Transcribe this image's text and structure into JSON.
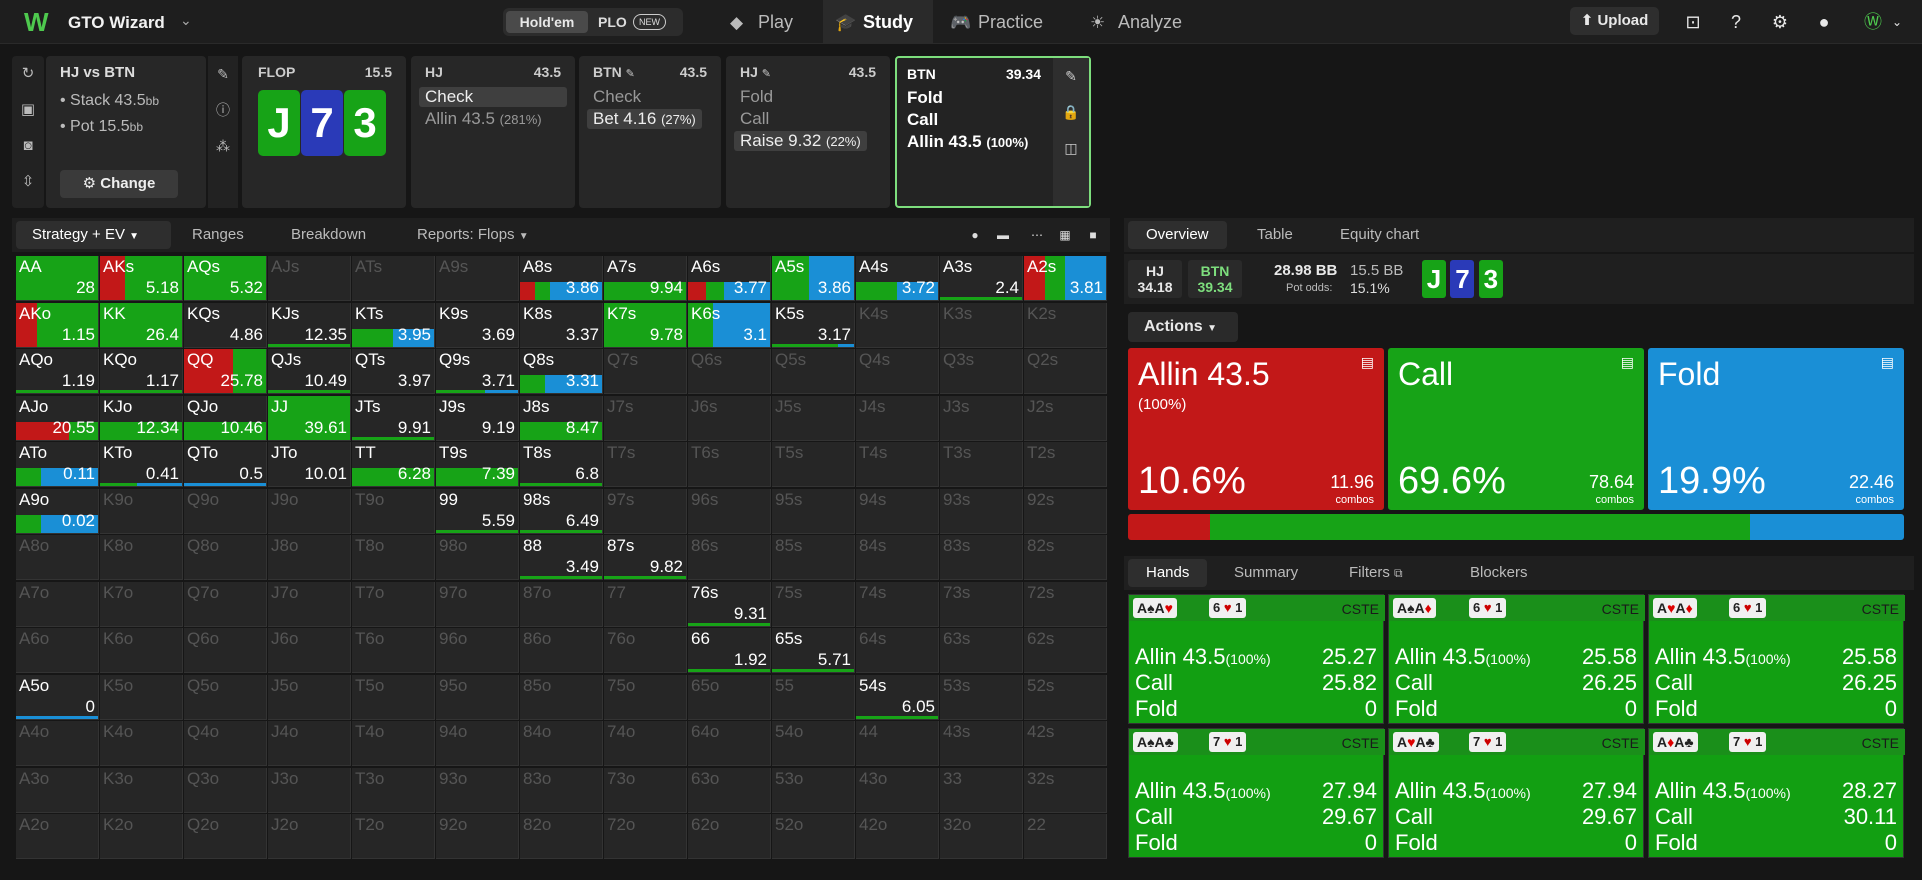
{
  "app": {
    "title": "GTO Wizard",
    "gametypes": [
      "Hold'em",
      "PLO"
    ],
    "new_badge": "NEW",
    "nav": [
      "Play",
      "Study",
      "Practice",
      "Analyze"
    ],
    "upload": "Upload"
  },
  "scenario": {
    "title": "HJ vs BTN",
    "stack_label": "Stack",
    "stack": "43.5",
    "pot_label": "Pot",
    "pot": "15.5",
    "unit": "bb",
    "change": "Change"
  },
  "flop": {
    "label": "FLOP",
    "pot": "15.5",
    "cards": [
      {
        "r": "J",
        "color": "#17a317"
      },
      {
        "r": "7",
        "color": "#2a3ab8"
      },
      {
        "r": "3",
        "color": "#17a317"
      }
    ]
  },
  "cards": [
    {
      "pos": "HJ",
      "stack": "43.5",
      "options": [
        {
          "name": "Check",
          "sel": true
        },
        {
          "name": "Allin 43.5",
          "pct": "(281%)"
        }
      ]
    },
    {
      "pos": "BTN",
      "stack": "43.5",
      "options": [
        {
          "name": "Check"
        },
        {
          "name": "Bet 4.16",
          "pct": "(27%)",
          "sel": true
        }
      ]
    },
    {
      "pos": "HJ",
      "stack": "43.5",
      "options": [
        {
          "name": "Fold"
        },
        {
          "name": "Call"
        },
        {
          "name": "Raise 9.32",
          "pct": "(22%)",
          "sel": true
        }
      ]
    },
    {
      "pos": "BTN",
      "stack": "39.34",
      "options": [
        {
          "name": "Fold"
        },
        {
          "name": "Call"
        },
        {
          "name": "Allin 43.5",
          "pct": "(100%)"
        }
      ]
    }
  ],
  "toolbar": {
    "strategy": "Strategy + EV",
    "ranges": "Ranges",
    "breakdown": "Breakdown",
    "reports": "Reports: Flops"
  },
  "colors": {
    "allin": "#c21818",
    "call": "#17a317",
    "fold": "#1a8fd6"
  },
  "grid": [
    {
      "h": "AA",
      "ev": "28",
      "s": [
        0,
        100,
        0
      ]
    },
    {
      "h": "AKs",
      "ev": "5.18",
      "s": [
        30,
        70,
        0
      ]
    },
    {
      "h": "AQs",
      "ev": "5.32",
      "s": [
        0,
        100,
        0
      ]
    },
    {
      "h": "AJs"
    },
    {
      "h": "ATs"
    },
    {
      "h": "A9s"
    },
    {
      "h": "A8s",
      "ev": "3.86",
      "s": [
        18,
        18,
        64
      ],
      "bar": true
    },
    {
      "h": "A7s",
      "ev": "9.94",
      "s": [
        0,
        100,
        0
      ],
      "bar": true
    },
    {
      "h": "A6s",
      "ev": "3.77",
      "s": [
        22,
        22,
        56
      ],
      "bar": true
    },
    {
      "h": "A5s",
      "ev": "3.86",
      "s": [
        0,
        45,
        55
      ]
    },
    {
      "h": "A4s",
      "ev": "3.72",
      "s": [
        0,
        50,
        50
      ],
      "bar": true
    },
    {
      "h": "A3s",
      "ev": "2.4",
      "s": [
        0,
        100,
        0
      ],
      "bar": true,
      "thin": true
    },
    {
      "h": "A2s",
      "ev": "3.81",
      "s": [
        25,
        25,
        50
      ]
    },
    {
      "h": "AKo",
      "ev": "1.15",
      "s": [
        25,
        75,
        0
      ]
    },
    {
      "h": "KK",
      "ev": "26.4",
      "s": [
        0,
        100,
        0
      ]
    },
    {
      "h": "KQs",
      "ev": "4.86"
    },
    {
      "h": "KJs",
      "ev": "12.35",
      "s": [
        0,
        100,
        0
      ],
      "bar": true,
      "thin": true
    },
    {
      "h": "KTs",
      "ev": "3.95",
      "s": [
        0,
        50,
        50
      ],
      "bar": true
    },
    {
      "h": "K9s",
      "ev": "3.69"
    },
    {
      "h": "K8s",
      "ev": "3.37"
    },
    {
      "h": "K7s",
      "ev": "9.78",
      "s": [
        0,
        100,
        0
      ]
    },
    {
      "h": "K6s",
      "ev": "3.1",
      "s": [
        0,
        30,
        70
      ]
    },
    {
      "h": "K5s",
      "ev": "3.17",
      "s": [
        0,
        80,
        20
      ],
      "bar": true,
      "thin": true
    },
    {
      "h": "K4s"
    },
    {
      "h": "K3s"
    },
    {
      "h": "K2s"
    },
    {
      "h": "AQo",
      "ev": "1.19",
      "s": [
        0,
        100,
        0
      ],
      "bar": true,
      "thin": true
    },
    {
      "h": "KQo",
      "ev": "1.17",
      "s": [
        0,
        100,
        0
      ],
      "bar": true,
      "thin": true
    },
    {
      "h": "QQ",
      "ev": "25.78",
      "s": [
        60,
        40,
        0
      ]
    },
    {
      "h": "QJs",
      "ev": "10.49",
      "s": [
        0,
        100,
        0
      ],
      "bar": true,
      "thin": true
    },
    {
      "h": "QTs",
      "ev": "3.97"
    },
    {
      "h": "Q9s",
      "ev": "3.71",
      "s": [
        0,
        60,
        40
      ],
      "bar": true,
      "thin": true
    },
    {
      "h": "Q8s",
      "ev": "3.31",
      "s": [
        0,
        30,
        70
      ],
      "bar": true
    },
    {
      "h": "Q7s"
    },
    {
      "h": "Q6s"
    },
    {
      "h": "Q5s"
    },
    {
      "h": "Q4s"
    },
    {
      "h": "Q3s"
    },
    {
      "h": "Q2s"
    },
    {
      "h": "AJo",
      "ev": "20.55",
      "s": [
        65,
        35,
        0
      ],
      "bar": true
    },
    {
      "h": "KJo",
      "ev": "12.34",
      "s": [
        0,
        100,
        0
      ],
      "bar": true
    },
    {
      "h": "QJo",
      "ev": "10.46",
      "s": [
        0,
        100,
        0
      ],
      "bar": true
    },
    {
      "h": "JJ",
      "ev": "39.61",
      "s": [
        0,
        100,
        0
      ]
    },
    {
      "h": "JTs",
      "ev": "9.91",
      "s": [
        0,
        100,
        0
      ],
      "bar": true,
      "thin": true
    },
    {
      "h": "J9s",
      "ev": "9.19"
    },
    {
      "h": "J8s",
      "ev": "8.47",
      "s": [
        0,
        100,
        0
      ],
      "bar": true
    },
    {
      "h": "J7s"
    },
    {
      "h": "J6s"
    },
    {
      "h": "J5s"
    },
    {
      "h": "J4s"
    },
    {
      "h": "J3s"
    },
    {
      "h": "J2s"
    },
    {
      "h": "ATo",
      "ev": "0.11",
      "s": [
        0,
        30,
        70
      ],
      "bar": true
    },
    {
      "h": "KTo",
      "ev": "0.41",
      "s": [
        0,
        45,
        55
      ],
      "bar": true,
      "thin": true
    },
    {
      "h": "QTo",
      "ev": "0.5",
      "s": [
        0,
        0,
        100
      ],
      "bar": true,
      "thin": true
    },
    {
      "h": "JTo",
      "ev": "10.01"
    },
    {
      "h": "TT",
      "ev": "6.28",
      "s": [
        0,
        100,
        0
      ],
      "bar": true
    },
    {
      "h": "T9s",
      "ev": "7.39",
      "s": [
        0,
        100,
        0
      ],
      "bar": true
    },
    {
      "h": "T8s",
      "ev": "6.8",
      "s": [
        0,
        100,
        0
      ],
      "bar": true,
      "thin": true
    },
    {
      "h": "T7s"
    },
    {
      "h": "T6s"
    },
    {
      "h": "T5s"
    },
    {
      "h": "T4s"
    },
    {
      "h": "T3s"
    },
    {
      "h": "T2s"
    },
    {
      "h": "A9o",
      "ev": "0.02",
      "s": [
        0,
        30,
        70
      ],
      "bar": true
    },
    {
      "h": "K9o"
    },
    {
      "h": "Q9o"
    },
    {
      "h": "J9o"
    },
    {
      "h": "T9o"
    },
    {
      "h": "99",
      "ev": "5.59",
      "s": [
        0,
        100,
        0
      ],
      "bar": true,
      "thin": true
    },
    {
      "h": "98s",
      "ev": "6.49",
      "s": [
        0,
        100,
        0
      ],
      "bar": true,
      "thin": true
    },
    {
      "h": "97s"
    },
    {
      "h": "96s"
    },
    {
      "h": "95s"
    },
    {
      "h": "94s"
    },
    {
      "h": "93s"
    },
    {
      "h": "92s"
    },
    {
      "h": "A8o"
    },
    {
      "h": "K8o"
    },
    {
      "h": "Q8o"
    },
    {
      "h": "J8o"
    },
    {
      "h": "T8o"
    },
    {
      "h": "98o"
    },
    {
      "h": "88",
      "ev": "3.49",
      "s": [
        0,
        100,
        0
      ],
      "bar": true,
      "thin": true
    },
    {
      "h": "87s",
      "ev": "9.82",
      "s": [
        0,
        100,
        0
      ],
      "bar": true,
      "thin": true
    },
    {
      "h": "86s"
    },
    {
      "h": "85s"
    },
    {
      "h": "84s"
    },
    {
      "h": "83s"
    },
    {
      "h": "82s"
    },
    {
      "h": "A7o"
    },
    {
      "h": "K7o"
    },
    {
      "h": "Q7o"
    },
    {
      "h": "J7o"
    },
    {
      "h": "T7o"
    },
    {
      "h": "97o"
    },
    {
      "h": "87o"
    },
    {
      "h": "77"
    },
    {
      "h": "76s",
      "ev": "9.31",
      "s": [
        0,
        100,
        0
      ],
      "bar": true,
      "thin": true
    },
    {
      "h": "75s"
    },
    {
      "h": "74s"
    },
    {
      "h": "73s"
    },
    {
      "h": "72s"
    },
    {
      "h": "A6o"
    },
    {
      "h": "K6o"
    },
    {
      "h": "Q6o"
    },
    {
      "h": "J6o"
    },
    {
      "h": "T6o"
    },
    {
      "h": "96o"
    },
    {
      "h": "86o"
    },
    {
      "h": "76o"
    },
    {
      "h": "66",
      "ev": "1.92",
      "s": [
        0,
        100,
        0
      ],
      "bar": true,
      "thin": true
    },
    {
      "h": "65s",
      "ev": "5.71",
      "s": [
        0,
        100,
        0
      ],
      "bar": true,
      "thin": true
    },
    {
      "h": "64s"
    },
    {
      "h": "63s"
    },
    {
      "h": "62s"
    },
    {
      "h": "A5o",
      "ev": "0",
      "s": [
        0,
        0,
        100
      ],
      "bar": true,
      "thin": true
    },
    {
      "h": "K5o"
    },
    {
      "h": "Q5o"
    },
    {
      "h": "J5o"
    },
    {
      "h": "T5o"
    },
    {
      "h": "95o"
    },
    {
      "h": "85o"
    },
    {
      "h": "75o"
    },
    {
      "h": "65o"
    },
    {
      "h": "55"
    },
    {
      "h": "54s",
      "ev": "6.05",
      "s": [
        0,
        100,
        0
      ],
      "bar": true,
      "thin": true
    },
    {
      "h": "53s"
    },
    {
      "h": "52s"
    },
    {
      "h": "A4o"
    },
    {
      "h": "K4o"
    },
    {
      "h": "Q4o"
    },
    {
      "h": "J4o"
    },
    {
      "h": "T4o"
    },
    {
      "h": "94o"
    },
    {
      "h": "84o"
    },
    {
      "h": "74o"
    },
    {
      "h": "64o"
    },
    {
      "h": "54o"
    },
    {
      "h": "44"
    },
    {
      "h": "43s"
    },
    {
      "h": "42s"
    },
    {
      "h": "A3o"
    },
    {
      "h": "K3o"
    },
    {
      "h": "Q3o"
    },
    {
      "h": "J3o"
    },
    {
      "h": "T3o"
    },
    {
      "h": "93o"
    },
    {
      "h": "83o"
    },
    {
      "h": "73o"
    },
    {
      "h": "63o"
    },
    {
      "h": "53o"
    },
    {
      "h": "43o"
    },
    {
      "h": "33"
    },
    {
      "h": "32s"
    },
    {
      "h": "A2o"
    },
    {
      "h": "K2o"
    },
    {
      "h": "Q2o"
    },
    {
      "h": "J2o"
    },
    {
      "h": "T2o"
    },
    {
      "h": "92o"
    },
    {
      "h": "82o"
    },
    {
      "h": "72o"
    },
    {
      "h": "62o"
    },
    {
      "h": "52o"
    },
    {
      "h": "42o"
    },
    {
      "h": "32o"
    },
    {
      "h": "22"
    }
  ],
  "right": {
    "tabs": [
      "Overview",
      "Table",
      "Equity chart"
    ],
    "hj": {
      "pos": "HJ",
      "val": "34.18"
    },
    "btn": {
      "pos": "BTN",
      "val": "39.34"
    },
    "pot": "28.98 BB",
    "pot2": "15.5 BB",
    "odds_label": "Pot odds:",
    "odds": "15.1%",
    "actions_label": "Actions",
    "actions": [
      {
        "name": "Allin 43.5",
        "sub": "(100%)",
        "pct": "10.6%",
        "combos": "11.96"
      },
      {
        "name": "Call",
        "pct": "69.6%",
        "combos": "78.64"
      },
      {
        "name": "Fold",
        "pct": "19.9%",
        "combos": "22.46"
      }
    ],
    "combos_label": "combos",
    "freq": [
      10.6,
      69.6,
      19.9
    ],
    "htabs": [
      "Hands",
      "Summary",
      "Filters",
      "Blockers"
    ],
    "hands": [
      {
        "cards": "A♠A♥",
        "b1": "6",
        "b2": "1",
        "tag": "CSTE",
        "allin": "25.27",
        "call": "25.82",
        "fold": "0"
      },
      {
        "cards": "A♠A♦",
        "b1": "6",
        "b2": "1",
        "tag": "CSTE",
        "allin": "25.58",
        "call": "26.25",
        "fold": "0"
      },
      {
        "cards": "A♥A♦",
        "b1": "6",
        "b2": "1",
        "tag": "CSTE",
        "allin": "25.58",
        "call": "26.25",
        "fold": "0"
      },
      {
        "cards": "A♠A♣",
        "b1": "7",
        "b2": "1",
        "tag": "CSTE",
        "allin": "27.94",
        "call": "29.67",
        "fold": "0"
      },
      {
        "cards": "A♥A♣",
        "b1": "7",
        "b2": "1",
        "tag": "CSTE",
        "allin": "27.94",
        "call": "29.67",
        "fold": "0"
      },
      {
        "cards": "A♦A♣",
        "b1": "7",
        "b2": "1",
        "tag": "CSTE",
        "allin": "28.27",
        "call": "30.11",
        "fold": "0"
      }
    ],
    "row_allin": "Allin 43.5",
    "row_allin_pct": "(100%)",
    "row_call": "Call",
    "row_fold": "Fold"
  }
}
